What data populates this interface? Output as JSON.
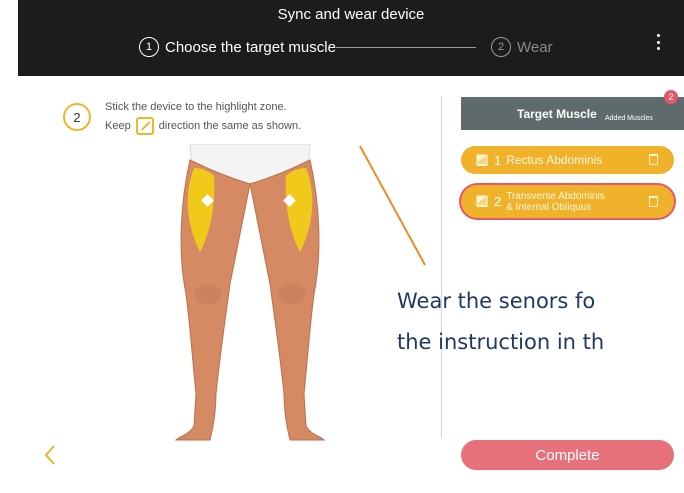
{
  "header": {
    "title": "Sync and wear device",
    "steps": [
      {
        "num": "1",
        "label": "Choose the target muscle"
      },
      {
        "num": "2",
        "label": "Wear"
      }
    ],
    "menu_icon": "more-vert-icon"
  },
  "instruction": {
    "step_num": "2",
    "line1": "Stick the device to the highlight zone.",
    "line2_before": "Keep",
    "line2_after": "direction the same as shown."
  },
  "annotation": {
    "line1": "Wear the senors fo",
    "line2": "the instruction in th"
  },
  "target_panel": {
    "title": "Target Muscle",
    "subtitle": "Added Muscles",
    "badge_count": "2",
    "items": [
      {
        "num": "1",
        "label": "Rectus Abdominis"
      },
      {
        "num": "2",
        "label_line1": "Transverse Abdominis",
        "label_line2": "& Internal Obliquus"
      }
    ]
  },
  "complete_label": "Complete",
  "colors": {
    "accent_yellow": "#f0b22a",
    "accent_pink": "#e5586a",
    "topbar": "#1c1c1c",
    "annotation_text": "#1f3864",
    "annotation_line": "#f08a24"
  }
}
